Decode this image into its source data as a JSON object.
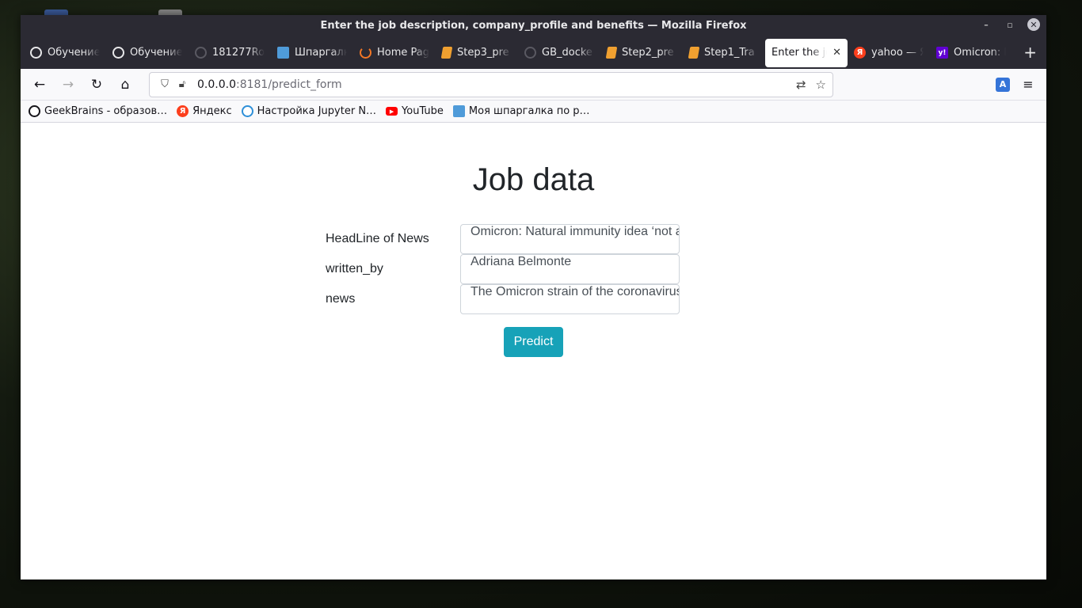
{
  "window": {
    "title": "Enter the job description, company_profile and benefits — Mozilla Firefox"
  },
  "tabs": [
    {
      "label": "Обучение",
      "icon": "openai-icon"
    },
    {
      "label": "Обучение",
      "icon": "openai-icon"
    },
    {
      "label": "181277Ro",
      "icon": "github-icon"
    },
    {
      "label": "Шпаргалк",
      "icon": "cheatsheet-icon"
    },
    {
      "label": "Home Pag",
      "icon": "jupyter-icon"
    },
    {
      "label": "Step3_pre",
      "icon": "notebook-icon"
    },
    {
      "label": "GB_docke",
      "icon": "github-icon"
    },
    {
      "label": "Step2_pre",
      "icon": "notebook-icon"
    },
    {
      "label": "Step1_Tra",
      "icon": "notebook-icon"
    },
    {
      "label": "Enter the jo",
      "icon": "",
      "active": true
    },
    {
      "label": "yahoo — Я",
      "icon": "yandex-icon"
    },
    {
      "label": "Omicron: N",
      "icon": "yahoo-icon"
    }
  ],
  "nav": {
    "url_host": "0.0.0.0",
    "url_rest": ":8181/predict_form"
  },
  "bookmarks": [
    {
      "label": "GeekBrains - образов…",
      "icon": "openai-icon"
    },
    {
      "label": "Яндекс",
      "icon": "yandex-icon"
    },
    {
      "label": "Настройка Jupyter N…",
      "icon": "jupyter-icon"
    },
    {
      "label": "YouTube",
      "icon": "youtube-icon"
    },
    {
      "label": "Моя шпаргалка по р…",
      "icon": "cheatsheet-icon"
    }
  ],
  "page": {
    "title": "Job data",
    "fields": [
      {
        "label": "HeadLine of News",
        "value": "Omicron: Natural immunity idea ‘not a good strategy’"
      },
      {
        "label": "written_by",
        "value": "Adriana Belmonte"
      },
      {
        "label": "news",
        "value": "The Omicron strain of the coronavirus"
      }
    ],
    "submit_label": "Predict"
  },
  "colors": {
    "accent": "#17a2b8",
    "chrome": "#2b2a33"
  }
}
